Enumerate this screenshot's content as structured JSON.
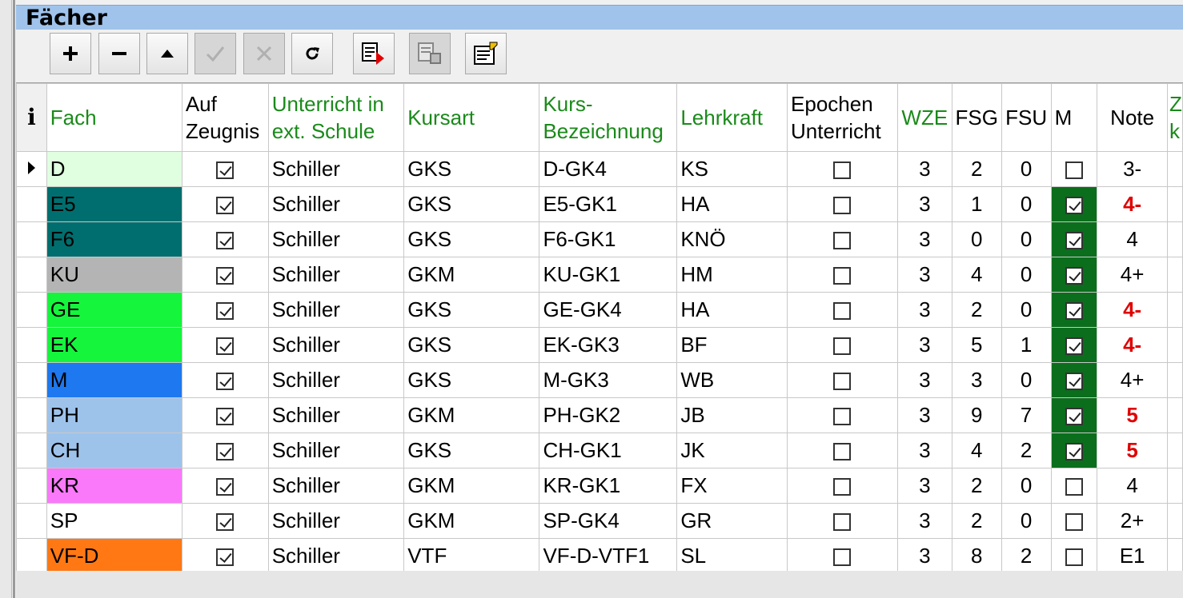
{
  "panel": {
    "title": "Fächer"
  },
  "toolbar": {
    "add_icon": "plus-icon",
    "remove_icon": "minus-icon",
    "up_icon": "triangle-up-icon",
    "confirm_icon": "check-icon",
    "cancel_icon": "x-icon",
    "refresh_icon": "refresh-icon"
  },
  "table": {
    "info_label": "i",
    "headers": {
      "fach": "Fach",
      "zeugnis": "Auf Zeugnis",
      "ext": "Unterricht in ext. Schule",
      "kursart": "Kursart",
      "kursbez": "Kurs-Bezeichnung",
      "lehrkraft": "Lehrkraft",
      "epochen": "Epochen Unterricht",
      "wze": "WZE",
      "fsg": "FSG",
      "fsu": "FSU",
      "m": "M",
      "note": "Note",
      "cut": "Z k"
    },
    "rows": [
      {
        "fach": "D",
        "fach_color": "#e0ffe0",
        "ext": "Schiller",
        "kursart": "GKS",
        "kursbez": "D-GK4",
        "lehrkraft": "KS",
        "wze": "3",
        "fsg": "2",
        "fsu": "0",
        "m": false,
        "note": "3-",
        "note_red": false
      },
      {
        "fach": "E5",
        "fach_color": "#006e6e",
        "ext": "Schiller",
        "kursart": "GKS",
        "kursbez": "E5-GK1",
        "lehrkraft": "HA",
        "wze": "3",
        "fsg": "1",
        "fsu": "0",
        "m": true,
        "note": "4-",
        "note_red": true
      },
      {
        "fach": "F6",
        "fach_color": "#006e6e",
        "ext": "Schiller",
        "kursart": "GKS",
        "kursbez": "F6-GK1",
        "lehrkraft": "KNÖ",
        "wze": "3",
        "fsg": "0",
        "fsu": "0",
        "m": true,
        "note": "4",
        "note_red": false
      },
      {
        "fach": "KU",
        "fach_color": "#b4b4b4",
        "ext": "Schiller",
        "kursart": "GKM",
        "kursbez": "KU-GK1",
        "lehrkraft": "HM",
        "wze": "3",
        "fsg": "4",
        "fsu": "0",
        "m": true,
        "note": "4+",
        "note_red": false
      },
      {
        "fach": "GE",
        "fach_color": "#14f53c",
        "ext": "Schiller",
        "kursart": "GKS",
        "kursbez": "GE-GK4",
        "lehrkraft": "HA",
        "wze": "3",
        "fsg": "2",
        "fsu": "0",
        "m": true,
        "note": "4-",
        "note_red": true
      },
      {
        "fach": "EK",
        "fach_color": "#14f53c",
        "ext": "Schiller",
        "kursart": "GKS",
        "kursbez": "EK-GK3",
        "lehrkraft": "BF",
        "wze": "3",
        "fsg": "5",
        "fsu": "1",
        "m": true,
        "note": "4-",
        "note_red": true
      },
      {
        "fach": "M",
        "fach_color": "#1e78f0",
        "ext": "Schiller",
        "kursart": "GKS",
        "kursbez": "M-GK3",
        "lehrkraft": "WB",
        "wze": "3",
        "fsg": "3",
        "fsu": "0",
        "m": true,
        "note": "4+",
        "note_red": false
      },
      {
        "fach": "PH",
        "fach_color": "#9ec3eb",
        "ext": "Schiller",
        "kursart": "GKM",
        "kursbez": "PH-GK2",
        "lehrkraft": "JB",
        "wze": "3",
        "fsg": "9",
        "fsu": "7",
        "m": true,
        "note": "5",
        "note_red": true
      },
      {
        "fach": "CH",
        "fach_color": "#9ec3eb",
        "ext": "Schiller",
        "kursart": "GKS",
        "kursbez": "CH-GK1",
        "lehrkraft": "JK",
        "wze": "3",
        "fsg": "4",
        "fsu": "2",
        "m": true,
        "note": "5",
        "note_red": true
      },
      {
        "fach": "KR",
        "fach_color": "#fa78fa",
        "ext": "Schiller",
        "kursart": "GKM",
        "kursbez": "KR-GK1",
        "lehrkraft": "FX",
        "wze": "3",
        "fsg": "2",
        "fsu": "0",
        "m": false,
        "note": "4",
        "note_red": false
      },
      {
        "fach": "SP",
        "fach_color": "#ffffff",
        "ext": "Schiller",
        "kursart": "GKM",
        "kursbez": "SP-GK4",
        "lehrkraft": "GR",
        "wze": "3",
        "fsg": "2",
        "fsu": "0",
        "m": false,
        "note": "2+",
        "note_red": false
      },
      {
        "fach": "VF-D",
        "fach_color": "#ff7814",
        "ext": "Schiller",
        "kursart": "VTF",
        "kursbez": "VF-D-VTF1",
        "lehrkraft": "SL",
        "wze": "3",
        "fsg": "8",
        "fsu": "2",
        "m": false,
        "note": "E1",
        "note_red": false
      }
    ]
  }
}
